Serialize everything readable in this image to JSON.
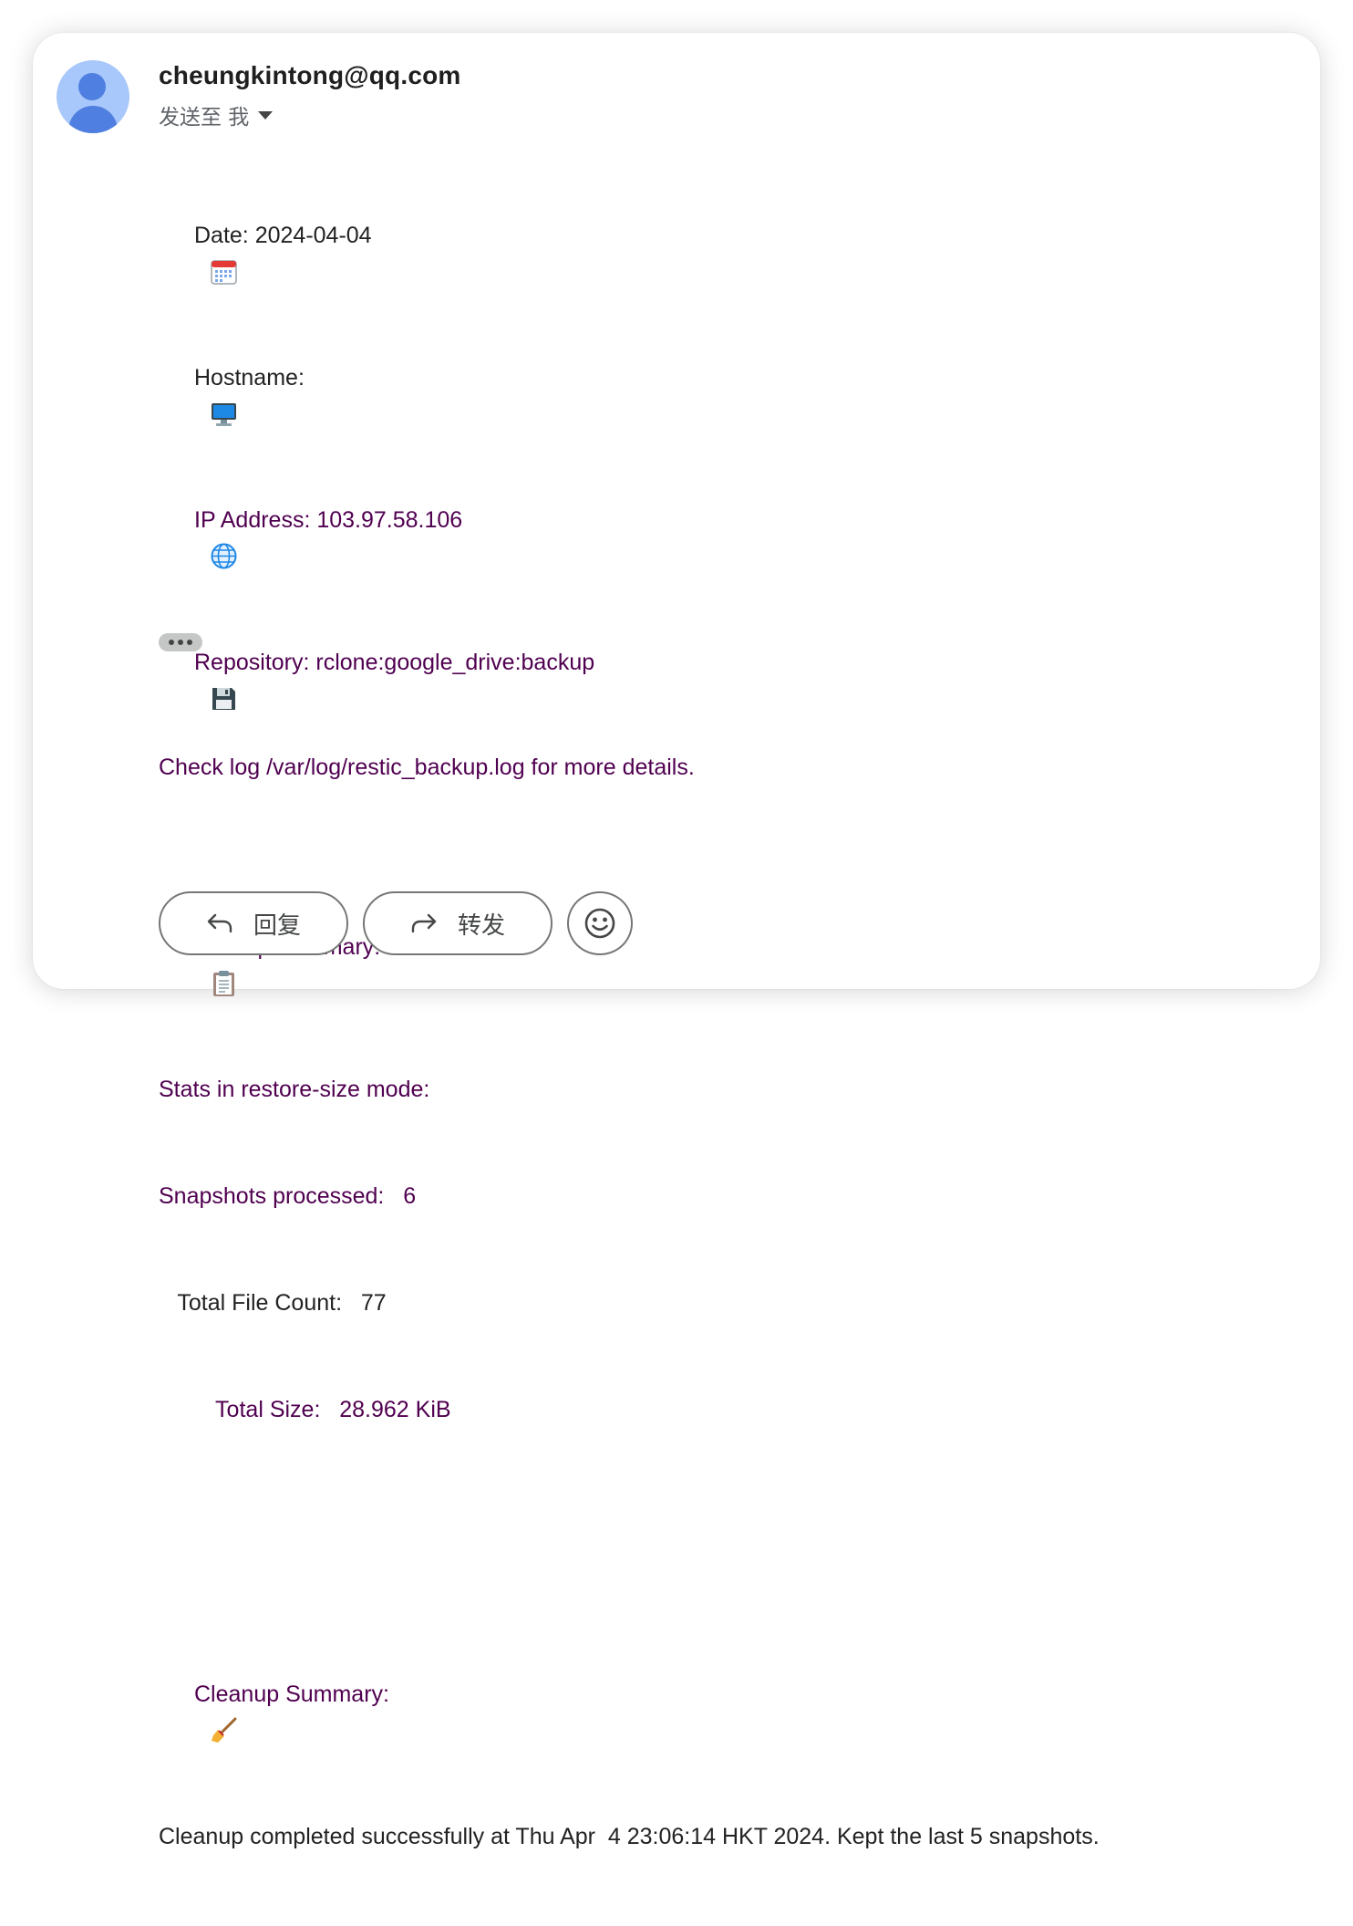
{
  "sender": {
    "email": "cheungkintong@qq.com",
    "recipient_label": "发送至 我"
  },
  "email_body": {
    "date": "Date: 2024-04-04",
    "hostname": "Hostname:",
    "ip": "IP Address: 103.97.58.106",
    "repository": "Repository: rclone:google_drive:backup",
    "backup_summary_title": "Backup Summary:",
    "stats_mode": "Stats in restore-size mode:",
    "snapshots_processed": "Snapshots processed:   6",
    "total_file_count": "   Total File Count:   77",
    "total_size": "         Total Size:   28.962 KiB",
    "cleanup_summary_title": "Cleanup Summary:",
    "cleanup_message": "Cleanup completed successfully at Thu Apr  4 23:06:14 HKT 2024. Kept the last 5 snapshots.",
    "footer": "Check log /var/log/restic_backup.log for more details."
  },
  "icons": [
    "calendar-icon",
    "desktop-computer-icon",
    "globe-icon",
    "floppy-disk-icon",
    "clipboard-icon",
    "broom-icon"
  ],
  "actions": {
    "reply": "回复",
    "forward": "转发"
  },
  "colors": {
    "link_purple": "#500050",
    "avatar_bg": "#a8c7fa",
    "avatar_fg": "#4f7fe0"
  }
}
